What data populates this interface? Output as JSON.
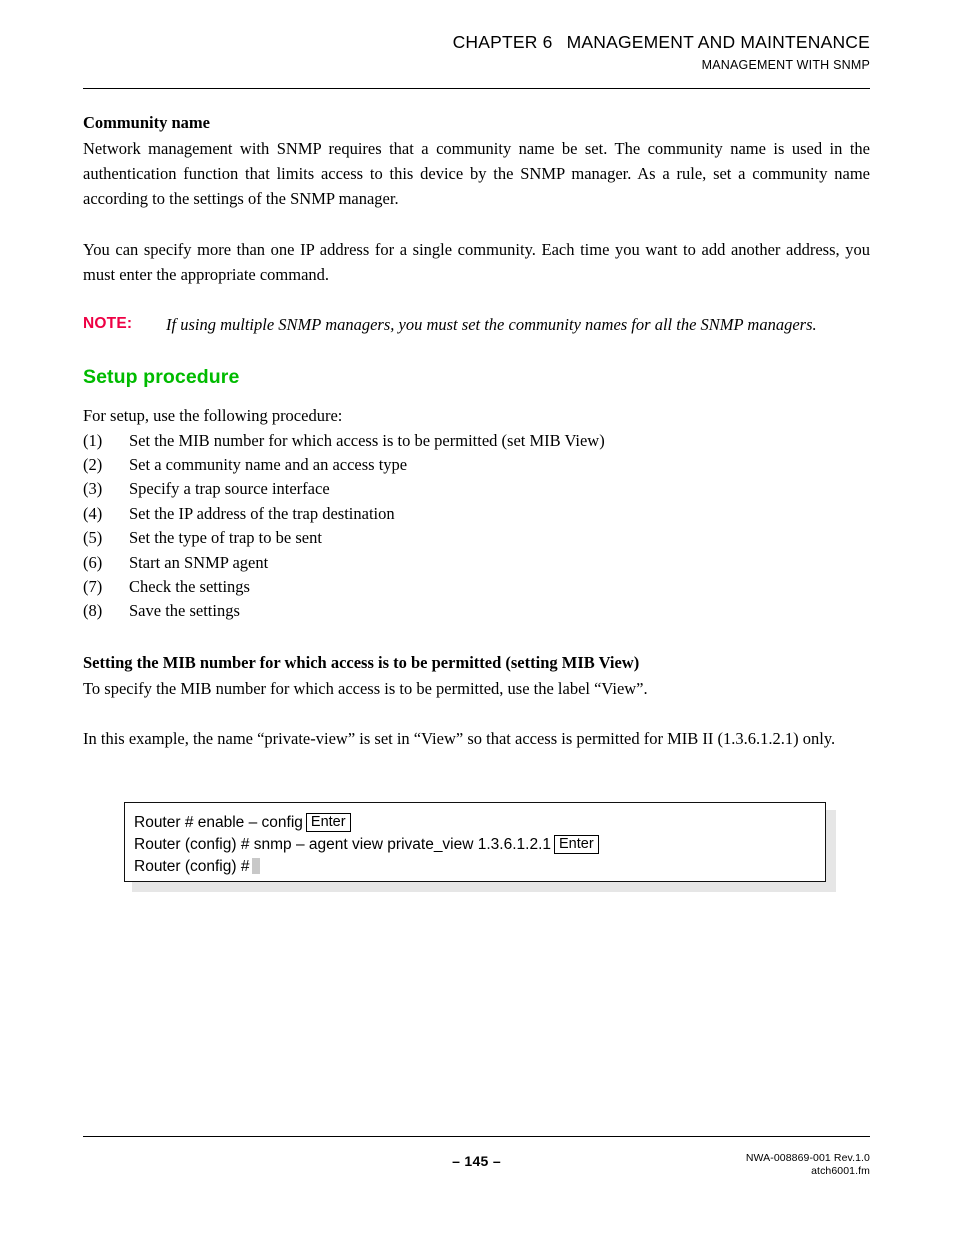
{
  "header": {
    "chapter_label": "CHAPTER 6",
    "chapter_title": "MANAGEMENT AND MAINTENANCE",
    "subtitle": "MANAGEMENT WITH SNMP"
  },
  "community": {
    "heading": "Community name",
    "paragraph_1": "Network management with SNMP requires that a community name be set. The community name is used in the authentication function that limits access to this device by the SNMP manager. As a rule, set a community name according to the settings of the SNMP manager.",
    "paragraph_2": "You can specify more than one IP address for a single community. Each time you want to add another address, you must enter the appropriate command."
  },
  "note": {
    "label": "NOTE:",
    "text": "If using multiple SNMP managers, you must set the community names for all the SNMP managers."
  },
  "setup": {
    "heading": "Setup procedure",
    "intro": "For setup, use the following procedure:",
    "steps": [
      {
        "num": "(1)",
        "text": "Set the MIB number for which access is to be permitted (set MIB View)"
      },
      {
        "num": "(2)",
        "text": "Set a community name and an access type"
      },
      {
        "num": "(3)",
        "text": "Specify a trap source interface"
      },
      {
        "num": "(4)",
        "text": "Set the IP address of the trap destination"
      },
      {
        "num": "(5)",
        "text": "Set the type of trap to be sent"
      },
      {
        "num": "(6)",
        "text": "Start an SNMP agent"
      },
      {
        "num": "(7)",
        "text": "Check the settings"
      },
      {
        "num": "(8)",
        "text": "Save the settings"
      }
    ]
  },
  "mib_section": {
    "heading": "Setting the MIB number for which access is to be permitted (setting MIB View)",
    "paragraph_1": "To specify the MIB number for which access is to be permitted, use the label “View”.",
    "paragraph_2": "In this example, the name “private-view” is set in “View” so that access is permitted for MIB II (1.3.6.1.2.1) only."
  },
  "console": {
    "line_1_prompt": "Router # enable – config",
    "line_1_key": "Enter",
    "line_2_prompt": "Router (config) # snmp – agent view private_view 1.3.6.1.2.1",
    "line_2_key": "Enter",
    "line_3_prompt": "Router (config) #"
  },
  "footer": {
    "page_number": "– 145 –",
    "doc_id": "NWA-008869-001 Rev.1.0",
    "file_name": "atch6001.fm"
  },
  "colors": {
    "note_accent": "#ee0044",
    "section_heading": "#00bb00",
    "rule": "#000000",
    "console_shadow": "#e6e6e6",
    "caret": "#c8c8c8"
  }
}
